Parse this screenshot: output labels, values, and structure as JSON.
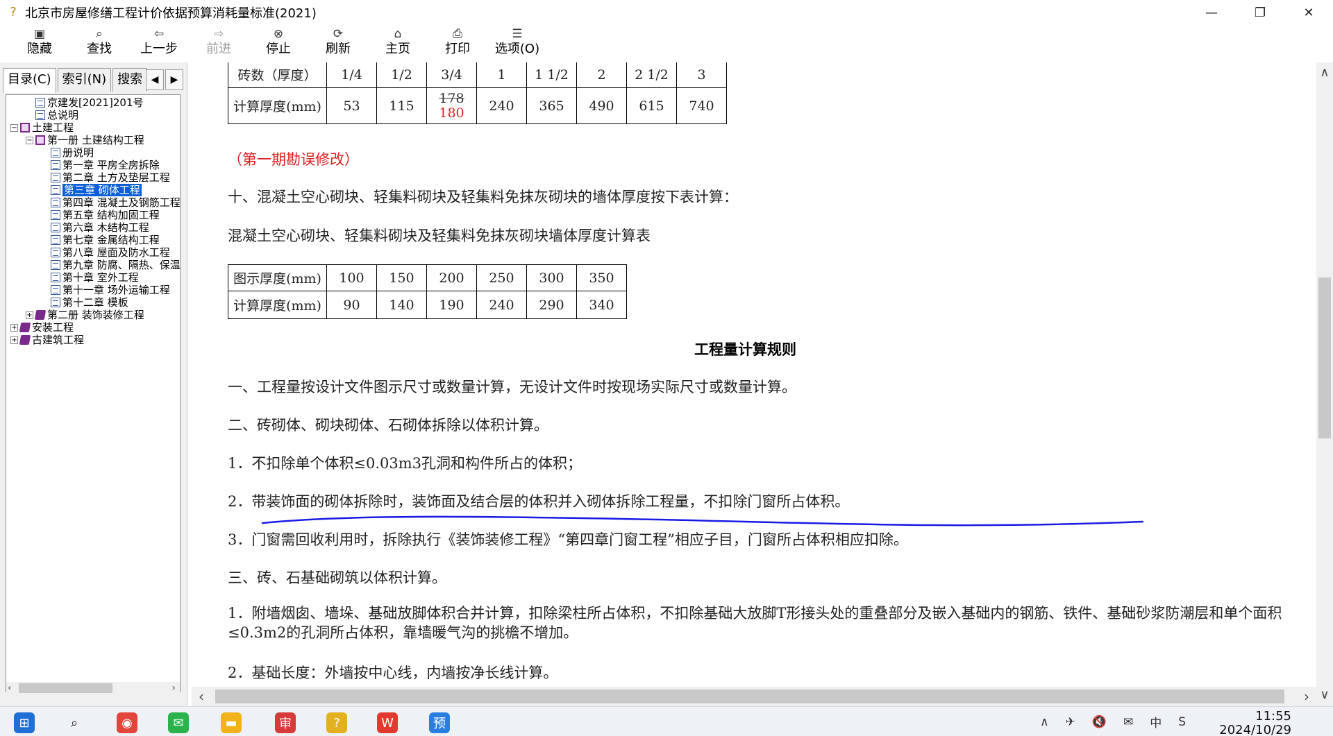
{
  "window": {
    "title": "北京市房屋修缮工程计价依据预算消耗量标准(2021)",
    "controls": [
      "—",
      "❐",
      "✕"
    ]
  },
  "toolbar": [
    {
      "label": "隐藏",
      "icon": "hide-icon",
      "glyph": "▣",
      "enabled": true
    },
    {
      "label": "查找",
      "icon": "find-icon",
      "glyph": "⌕",
      "enabled": true
    },
    {
      "label": "上一步",
      "icon": "back-icon",
      "glyph": "⇦",
      "enabled": true
    },
    {
      "label": "前进",
      "icon": "forward-icon",
      "glyph": "⇨",
      "enabled": false
    },
    {
      "label": "停止",
      "icon": "stop-icon",
      "glyph": "⊗",
      "enabled": true
    },
    {
      "label": "刷新",
      "icon": "refresh-icon",
      "glyph": "⟳",
      "enabled": true
    },
    {
      "label": "主页",
      "icon": "home-icon",
      "glyph": "⌂",
      "enabled": true
    },
    {
      "label": "打印",
      "icon": "print-icon",
      "glyph": "⎙",
      "enabled": true
    },
    {
      "label": "选项(O)",
      "icon": "options-icon",
      "glyph": "☰",
      "enabled": true
    }
  ],
  "tabs": [
    {
      "label": "目录(C)",
      "active": true
    },
    {
      "label": "索引(N)",
      "active": false
    },
    {
      "label": "搜索",
      "active": false
    }
  ],
  "tree": [
    {
      "label": "京建发[2021]201号",
      "level": 1,
      "type": "page",
      "expand": ""
    },
    {
      "label": "总说明",
      "level": 1,
      "type": "page",
      "expand": ""
    },
    {
      "label": "土建工程",
      "level": 0,
      "type": "openbook",
      "expand": "−"
    },
    {
      "label": "第一册 土建结构工程",
      "level": 1,
      "type": "openbook",
      "expand": "−"
    },
    {
      "label": "册说明",
      "level": 2,
      "type": "page",
      "expand": ""
    },
    {
      "label": "第一章 平房全房拆除",
      "level": 2,
      "type": "page",
      "expand": ""
    },
    {
      "label": "第二章 土方及垫层工程",
      "level": 2,
      "type": "page",
      "expand": ""
    },
    {
      "label": "第三章 砌体工程",
      "level": 2,
      "type": "page",
      "expand": "",
      "selected": true
    },
    {
      "label": "第四章 混凝土及钢筋工程",
      "level": 2,
      "type": "page",
      "expand": ""
    },
    {
      "label": "第五章 结构加固工程",
      "level": 2,
      "type": "page",
      "expand": ""
    },
    {
      "label": "第六章 木结构工程",
      "level": 2,
      "type": "page",
      "expand": ""
    },
    {
      "label": "第七章 金属结构工程",
      "level": 2,
      "type": "page",
      "expand": ""
    },
    {
      "label": "第八章 屋面及防水工程",
      "level": 2,
      "type": "page",
      "expand": ""
    },
    {
      "label": "第九章 防腐、隔热、保温工程",
      "level": 2,
      "type": "page",
      "expand": ""
    },
    {
      "label": "第十章 室外工程",
      "level": 2,
      "type": "page",
      "expand": ""
    },
    {
      "label": "第十一章 场外运输工程",
      "level": 2,
      "type": "page",
      "expand": ""
    },
    {
      "label": "第十二章 模板",
      "level": 2,
      "type": "page",
      "expand": ""
    },
    {
      "label": "第二册 装饰装修工程",
      "level": 1,
      "type": "book",
      "expand": "+"
    },
    {
      "label": "安装工程",
      "level": 0,
      "type": "book",
      "expand": "+"
    },
    {
      "label": "古建筑工程",
      "level": 0,
      "type": "book",
      "expand": "+"
    }
  ],
  "brick_table": {
    "row1_header": "砖数（厚度）",
    "row1": [
      "1/4",
      "1/2",
      "3/4",
      "1",
      "1 1/2",
      "2",
      "2 1/2",
      "3"
    ],
    "row2_header": "计算厚度(mm)",
    "row2": [
      "53",
      "115",
      "",
      "240",
      "365",
      "490",
      "615",
      "740"
    ],
    "corrected_old": "178",
    "corrected_new": "180"
  },
  "correction_note": "（第一期勘误修改）",
  "para_10": "十、混凝土空心砌块、轻集料砌块及轻集料免抹灰砌块的墙体厚度按下表计算：",
  "table2_title": "混凝土空心砌块、轻集料砌块及轻集料免抹灰砌块墙体厚度计算表",
  "block_table": {
    "row1_header": "图示厚度(mm)",
    "row1": [
      "100",
      "150",
      "200",
      "250",
      "300",
      "350"
    ],
    "row2_header": "计算厚度(mm)",
    "row2": [
      "90",
      "140",
      "190",
      "240",
      "290",
      "340"
    ]
  },
  "rules_heading": "工程量计算规则",
  "paragraphs": {
    "p1": "一、工程量按设计文件图示尺寸或数量计算，无设计文件时按现场实际尺寸或数量计算。",
    "p2": "二、砖砌体、砌块砌体、石砌体拆除以体积计算。",
    "p2_1": "1．不扣除单个体积≤0.03m3孔洞和构件所占的体积；",
    "p2_2": "2．带装饰面的砌体拆除时，装饰面及结合层的体积并入砌体拆除工程量，不扣除门窗所占体积。",
    "p2_3": "3．门窗需回收利用时，拆除执行《装饰装修工程》“第四章门窗工程”相应子目，门窗所占体积相应扣除。",
    "p3": "三、砖、石基础砌筑以体积计算。",
    "p3_1": "1．附墙烟囱、墙垛、基础放脚体积合并计算，扣除梁柱所占体积，不扣除基础大放脚T形接头处的重叠部分及嵌入基础内的钢筋、铁件、基础砂浆防潮层和单个面积≤0.3m2的孔洞所占体积，靠墙暖气沟的挑檐不增加。",
    "p3_2": "2．基础长度：外墙按中心线，内墙按净长线计算。"
  },
  "annotation_color": "#1a1ae6",
  "taskbar": {
    "apps": [
      {
        "name": "start-icon",
        "glyph": "⊞",
        "color": "#1f6fd6"
      },
      {
        "name": "search-icon",
        "glyph": "⌕",
        "color": "#222222"
      },
      {
        "name": "chrome-icon",
        "glyph": "◉",
        "color": "#e2463b"
      },
      {
        "name": "wechat-icon",
        "glyph": "✉",
        "color": "#2bb24c"
      },
      {
        "name": "folder-icon",
        "glyph": "▬",
        "color": "#f2b21c"
      },
      {
        "name": "app-shen-icon",
        "glyph": "审",
        "color": "#d83a3a"
      },
      {
        "name": "help-icon",
        "glyph": "?",
        "color": "#e3b020"
      },
      {
        "name": "wps-icon",
        "glyph": "W",
        "color": "#e23a2e"
      },
      {
        "name": "app-yu-icon",
        "glyph": "预",
        "color": "#2a7ee0"
      }
    ],
    "tray": [
      "∧",
      "✈",
      "🔇",
      "✉",
      "中",
      "S"
    ],
    "time": "11:55",
    "date": "2024/10/29"
  }
}
